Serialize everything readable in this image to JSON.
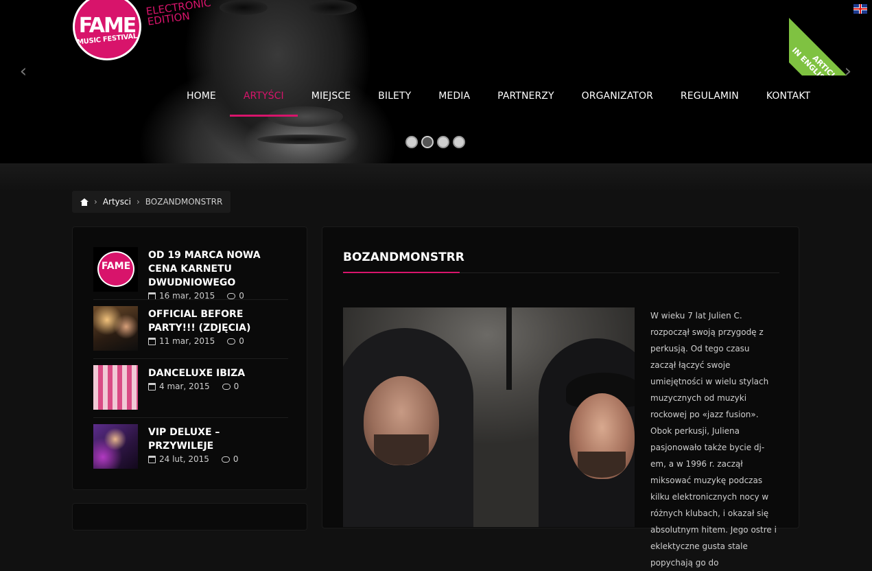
{
  "header": {
    "logo_main": "FAME",
    "logo_sub": "MUSIC FESTIVAL",
    "logo_edition_line1": "ELECTRONIC",
    "logo_edition_line2": "EDITION",
    "ribbon_line1": "ARTICLES",
    "ribbon_line2": "IN ENGLISH INSIDE",
    "prev_arrow": "‹",
    "next_arrow": "›"
  },
  "nav": {
    "items": [
      {
        "label": "HOME"
      },
      {
        "label": "ARTYŚCI"
      },
      {
        "label": "MIEJSCE"
      },
      {
        "label": "BILETY"
      },
      {
        "label": "MEDIA"
      },
      {
        "label": "PARTNERZY"
      },
      {
        "label": "ORGANIZATOR"
      },
      {
        "label": "REGULAMIN"
      },
      {
        "label": "KONTAKT"
      }
    ],
    "active": "ARTYŚCI"
  },
  "slider": {
    "count": 4,
    "active_index": 1
  },
  "breadcrumb": {
    "sep": "›",
    "parent": "Artysci",
    "current": "BOZANDMONSTRR"
  },
  "sidebar": {
    "posts": [
      {
        "title": "OD 19 MARCA NOWA CENA KARNETU DWUDNIOWEGO",
        "date": "16 mar, 2015",
        "comments": "0"
      },
      {
        "title": "OFFICIAL BEFORE PARTY!!! (ZDJĘCIA)",
        "date": "11 mar, 2015",
        "comments": "0"
      },
      {
        "title": "DANCELUXE IBIZA",
        "date": "4 mar, 2015",
        "comments": "0"
      },
      {
        "title": "VIP DELUXE – PRZYWILEJE",
        "date": "24 lut, 2015",
        "comments": "0"
      }
    ]
  },
  "article": {
    "title": "BOZANDMONSTRR",
    "body": "W wieku 7 lat Julien C. rozpoczął swoją przygodę z perkusją. Od tego czasu zaczął łączyć swoje umiejętności w wielu stylach muzycznych od muzyki rockowej po «jazz fusion». Obok perkusji, Juliena pasjonowało także bycie dj-em, a w 1996 r. zaczął miksować muzykę podczas kilku elektronicznych nocy w różnych klubach, i okazał się absolutnym hitem. Jego ostre i eklektyczne gusta stale popychają go do"
  },
  "colors": {
    "accent": "#d8146b",
    "ribbon": "#7fc241",
    "background": "#111111",
    "panel": "#0a0a0a"
  }
}
